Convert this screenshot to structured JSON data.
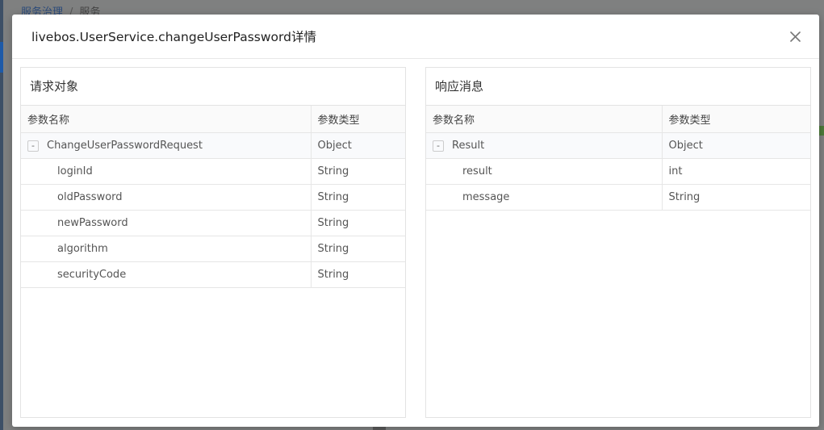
{
  "background": {
    "breadcrumb": {
      "parent": "服务治理",
      "separator": "/",
      "current": "服务"
    }
  },
  "modal": {
    "title": "livebos.UserService.changeUserPassword详情",
    "close_icon": "close-icon"
  },
  "request_panel": {
    "title": "请求对象",
    "columns": {
      "name": "参数名称",
      "type": "参数类型"
    },
    "root": {
      "toggle": "-",
      "name": "ChangeUserPasswordRequest",
      "type": "Object"
    },
    "children": [
      {
        "name": "loginId",
        "type": "String"
      },
      {
        "name": "oldPassword",
        "type": "String"
      },
      {
        "name": "newPassword",
        "type": "String"
      },
      {
        "name": "algorithm",
        "type": "String"
      },
      {
        "name": "securityCode",
        "type": "String"
      }
    ]
  },
  "response_panel": {
    "title": "响应消息",
    "columns": {
      "name": "参数名称",
      "type": "参数类型"
    },
    "root": {
      "toggle": "-",
      "name": "Result",
      "type": "Object"
    },
    "children": [
      {
        "name": "result",
        "type": "int"
      },
      {
        "name": "message",
        "type": "String"
      }
    ]
  },
  "colors": {
    "overlay": "#7f8080",
    "breadcrumb_link": "#2c4b7a",
    "border": "#e3e3e3",
    "header_bg": "#fafafa"
  }
}
